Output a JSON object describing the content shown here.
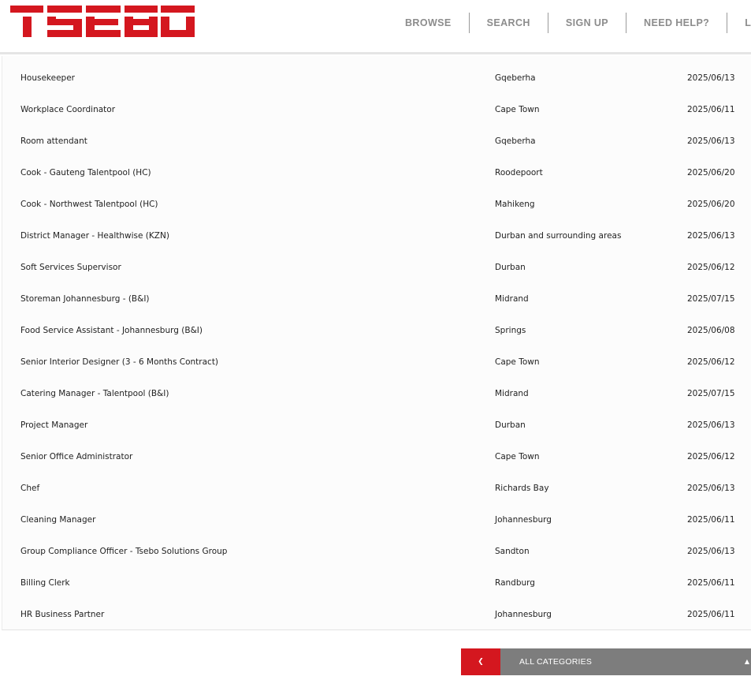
{
  "brand": {
    "logo_text": "TSEBO",
    "color": "#d4171f"
  },
  "nav": {
    "items": [
      {
        "label": "BROWSE"
      },
      {
        "label": "SEARCH"
      },
      {
        "label": "SIGN UP"
      },
      {
        "label": "NEED HELP?"
      },
      {
        "label": "LOG"
      }
    ]
  },
  "jobs": [
    {
      "title": "Housekeeper",
      "location": "Gqeberha",
      "date": "2025/06/13"
    },
    {
      "title": "Workplace Coordinator",
      "location": "Cape Town",
      "date": "2025/06/11"
    },
    {
      "title": "Room attendant",
      "location": "Gqeberha",
      "date": "2025/06/13"
    },
    {
      "title": "Cook - Gauteng Talentpool (HC)",
      "location": "Roodepoort",
      "date": "2025/06/20"
    },
    {
      "title": "Cook - Northwest Talentpool (HC)",
      "location": "Mahikeng",
      "date": "2025/06/20"
    },
    {
      "title": "District Manager - Healthwise (KZN)",
      "location": "Durban and surrounding areas",
      "date": "2025/06/13"
    },
    {
      "title": "Soft Services Supervisor",
      "location": "Durban",
      "date": "2025/06/12"
    },
    {
      "title": "Storeman Johannesburg - (B&I)",
      "location": "Midrand",
      "date": "2025/07/15"
    },
    {
      "title": "Food Service Assistant - Johannesburg (B&I)",
      "location": "Springs",
      "date": "2025/06/08"
    },
    {
      "title": "Senior Interior Designer (3 - 6 Months Contract)",
      "location": "Cape Town",
      "date": "2025/06/12"
    },
    {
      "title": "Catering Manager - Talentpool (B&I)",
      "location": "Midrand",
      "date": "2025/07/15"
    },
    {
      "title": "Project Manager",
      "location": "Durban",
      "date": "2025/06/13"
    },
    {
      "title": "Senior Office Administrator",
      "location": "Cape Town",
      "date": "2025/06/12"
    },
    {
      "title": "Chef",
      "location": "Richards Bay",
      "date": "2025/06/13"
    },
    {
      "title": "Cleaning Manager",
      "location": "Johannesburg",
      "date": "2025/06/11"
    },
    {
      "title": "Group Compliance Officer - Tsebo Solutions Group",
      "location": "Sandton",
      "date": "2025/06/13"
    },
    {
      "title": "Billing Clerk",
      "location": "Randburg",
      "date": "2025/06/11"
    },
    {
      "title": "HR Business Partner",
      "location": "Johannesburg",
      "date": "2025/06/11"
    }
  ],
  "footer": {
    "back_icon": "chevron-left-icon",
    "category_label": "ALL CATEGORIES",
    "expand_icon": "caret-up-icon"
  }
}
